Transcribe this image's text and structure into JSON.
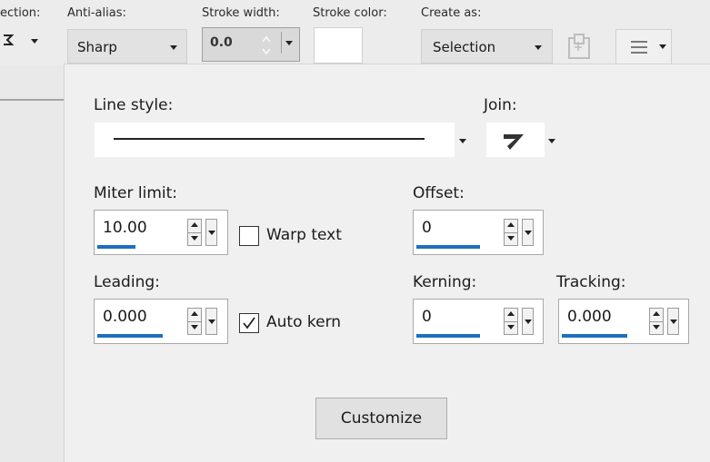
{
  "toolbar": {
    "selection_label": "ection:",
    "anti_alias_label": "Anti-alias:",
    "anti_alias_value": "Sharp",
    "stroke_width_label": "Stroke width:",
    "stroke_width_value": "0.0",
    "stroke_color_label": "Stroke color:",
    "stroke_color": "#ffffff",
    "create_as_label": "Create as:",
    "create_as_value": "Selection"
  },
  "panel": {
    "line_style_label": "Line style:",
    "join_label": "Join:",
    "miter_limit_label": "Miter limit:",
    "miter_limit_value": "10.00",
    "warp_text_label": "Warp text",
    "warp_text_checked": false,
    "offset_label": "Offset:",
    "offset_value": "0",
    "leading_label": "Leading:",
    "leading_value": "0.000",
    "auto_kern_label": "Auto kern",
    "auto_kern_checked": true,
    "kerning_label": "Kerning:",
    "kerning_value": "0",
    "tracking_label": "Tracking:",
    "tracking_value": "0.000",
    "customize_label": "Customize"
  },
  "colors": {
    "accent": "#1d6fc0",
    "panel_bg": "#f0f0f0"
  }
}
